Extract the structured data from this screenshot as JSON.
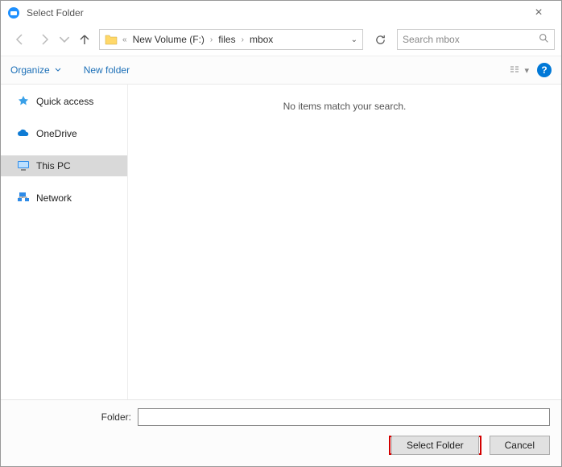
{
  "window": {
    "title": "Select Folder"
  },
  "breadcrumb": {
    "drive": "New Volume (F:)",
    "seg1": "files",
    "seg2": "mbox"
  },
  "search": {
    "placeholder": "Search mbox"
  },
  "toolbar": {
    "organize": "Organize",
    "newfolder": "New folder"
  },
  "sidebar": {
    "quick": "Quick access",
    "onedrive": "OneDrive",
    "thispc": "This PC",
    "network": "Network"
  },
  "content": {
    "empty": "No items match your search."
  },
  "footer": {
    "folder_label": "Folder:",
    "folder_value": "",
    "select": "Select Folder",
    "cancel": "Cancel"
  }
}
